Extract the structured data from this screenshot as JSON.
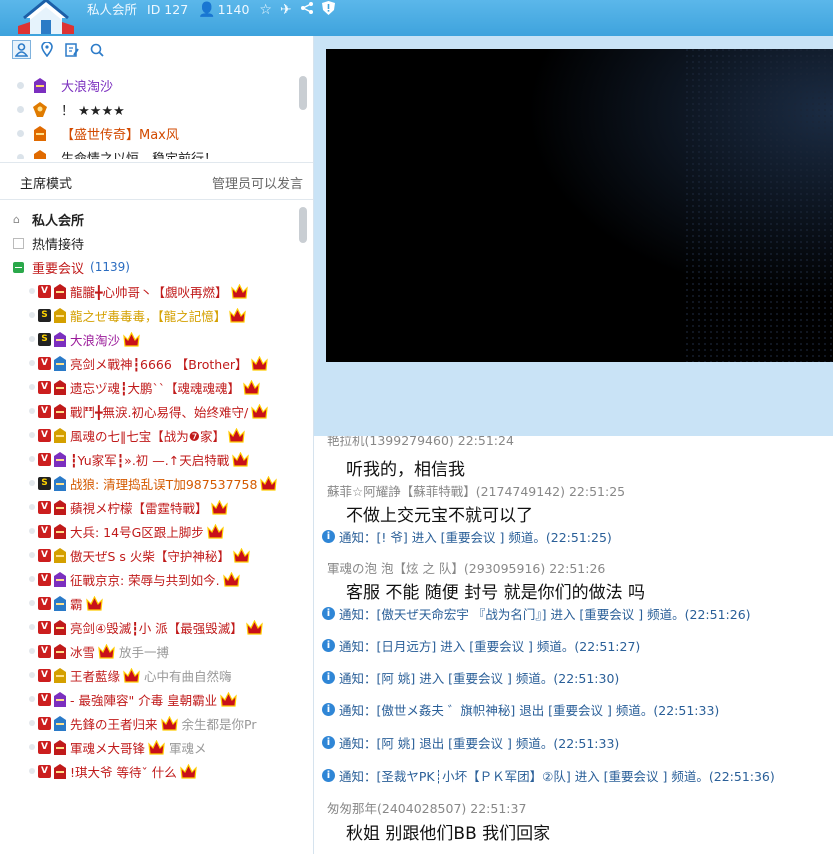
{
  "header": {
    "room_name": "私人会所",
    "room_id": "ID 127",
    "user_count": "1140",
    "icons": [
      "user-icon",
      "star-icon",
      "plane-icon",
      "share-icon",
      "shield-icon"
    ]
  },
  "left": {
    "tabs": [
      "user-tab-icon",
      "location-tab-icon",
      "edit-tab-icon",
      "search-tab-icon"
    ],
    "top_users": [
      {
        "name": "大浪淘沙",
        "color": "#7b2fbf"
      },
      {
        "name": "！ ★★★★",
        "color": "#222222"
      },
      {
        "name": "【盛世传奇】Max风",
        "color": "#d24a00"
      },
      {
        "name": "生命情之以恒，稳定前行！",
        "color": "#222222"
      }
    ],
    "mode": {
      "label": "主席模式",
      "hint": "管理员可以发言"
    },
    "tree": [
      {
        "label": "私人会所",
        "icon": "home"
      },
      {
        "label": "热情接待",
        "icon": "collapsed"
      },
      {
        "label": "重要会议",
        "count": "(1139)",
        "icon": "expanded"
      }
    ],
    "members": [
      {
        "lvl": "v",
        "name": "龍朧╋心帅哥丶【覷吙再燃】",
        "color": "#c01a1a",
        "extra": ""
      },
      {
        "lvl": "s",
        "name": "龍之ぜ毒毒毒，【龍之記憶】",
        "color": "#d4a000",
        "extra": ""
      },
      {
        "lvl": "s",
        "name": "大浪淘沙",
        "color": "#9a1a9a",
        "extra": ""
      },
      {
        "lvl": "v",
        "name": "亮剑メ戰神┇6666 【Brother】",
        "color": "#c01a1a",
        "extra": ""
      },
      {
        "lvl": "v",
        "name": "遗忘ヅ魂┇大鹏``【魂魂魂魂】",
        "color": "#c01a1a",
        "extra": ""
      },
      {
        "lvl": "v",
        "name": "戰鬥╋無淚.初心易得、始终难守/",
        "color": "#c01a1a",
        "extra": ""
      },
      {
        "lvl": "v",
        "name": "風魂の七‖七宝【战为❼家】",
        "color": "#c01a1a",
        "extra": ""
      },
      {
        "lvl": "v",
        "name": "┇Yu家军┇».初 —.↑天启特戰",
        "color": "#c01a1a",
        "extra": ""
      },
      {
        "lvl": "s",
        "name": "战狼: 清理捣乱误T加987537758",
        "color": "#d45a00",
        "extra": ""
      },
      {
        "lvl": "v",
        "name": "蘋視メ柠檬【雷霆特戰】",
        "color": "#c01a1a",
        "extra": ""
      },
      {
        "lvl": "v",
        "name": "大兵: 14号G区跟上脚步",
        "color": "#c01a1a",
        "extra": ""
      },
      {
        "lvl": "v",
        "name": "傲天ぜS s 火柴【守护神秘】",
        "color": "#c01a1a",
        "extra": ""
      },
      {
        "lvl": "v",
        "name": "征戰京京: 荣辱与共到如今.",
        "color": "#c01a1a",
        "extra": ""
      },
      {
        "lvl": "v",
        "name": "霸",
        "color": "#c01a1a",
        "extra": ""
      },
      {
        "lvl": "v",
        "name": "亮剑④毁滅┇小  派【最强毁滅】",
        "color": "#c01a1a",
        "extra": ""
      },
      {
        "lvl": "v",
        "name": "冰雪",
        "color": "#c01a1a",
        "extra": "放手一搏"
      },
      {
        "lvl": "v",
        "name": "王者藍缘",
        "color": "#c01a1a",
        "extra": "心中有曲自然嗨"
      },
      {
        "lvl": "v",
        "name": "- 最強陣容\" 介毒     皇朝霸业",
        "color": "#c01a1a",
        "extra": ""
      },
      {
        "lvl": "v",
        "name": "先鋒の王者归来",
        "color": "#c01a1a",
        "extra": "余生都是你Pr"
      },
      {
        "lvl": "v",
        "name": "軍魂メ大哥锋",
        "color": "#c01a1a",
        "extra": "軍魂メ"
      },
      {
        "lvl": "v",
        "name": "!琪大爷 等待ˇ 什么",
        "color": "#c01a1a",
        "extra": ""
      }
    ]
  },
  "chat": {
    "lines": [
      {
        "kind": "sender",
        "text": "艳拉机(1399279460) 22:51:24"
      },
      {
        "kind": "msg",
        "text": "听我的，相信我"
      },
      {
        "kind": "sender",
        "text": "蘇菲☆阿耀諍【蘇菲特戰】(2174749142) 22:51:25"
      },
      {
        "kind": "msg",
        "text": "不做上交元宝不就可以了"
      },
      {
        "kind": "notice",
        "text": "通知：[!    爷] 进入 [重要会议 ] 频道。(22:51:25)"
      },
      {
        "kind": "sender",
        "text": "軍魂の泡  泡【炫 之 队】(293095916) 22:51:26"
      },
      {
        "kind": "msg",
        "text": "客服 不能 随便  封号  就是你们的做法 吗"
      },
      {
        "kind": "notice",
        "text": "通知：[傲天ぜ天命宏宇    『战为名门』] 进入 [重要会议 ] 频道。(22:51:26)"
      },
      {
        "kind": "notice",
        "text": "通知：[日月远方] 进入 [重要会议 ] 频道。(22:51:27)"
      },
      {
        "kind": "notice",
        "text": "通知：[阿 姚] 进入 [重要会议 ] 频道。(22:51:30)"
      },
      {
        "kind": "notice",
        "text": "通知：[傲世メ姦夫        ゛旗帜神秘] 退出 [重要会议 ] 频道。(22:51:33)"
      },
      {
        "kind": "notice",
        "text": "通知：[阿 姚] 退出 [重要会议 ] 频道。(22:51:33)"
      },
      {
        "kind": "notice",
        "text": "通知：[圣裁ヤPK┊小坏【ＰＫ军团】②队] 进入 [重要会议 ] 频道。(22:51:36)"
      },
      {
        "kind": "sender",
        "text": "匆匆那年(2404028507) 22:51:37"
      },
      {
        "kind": "msg",
        "text": "秋姐 别跟他们BB 我们回家"
      }
    ]
  }
}
